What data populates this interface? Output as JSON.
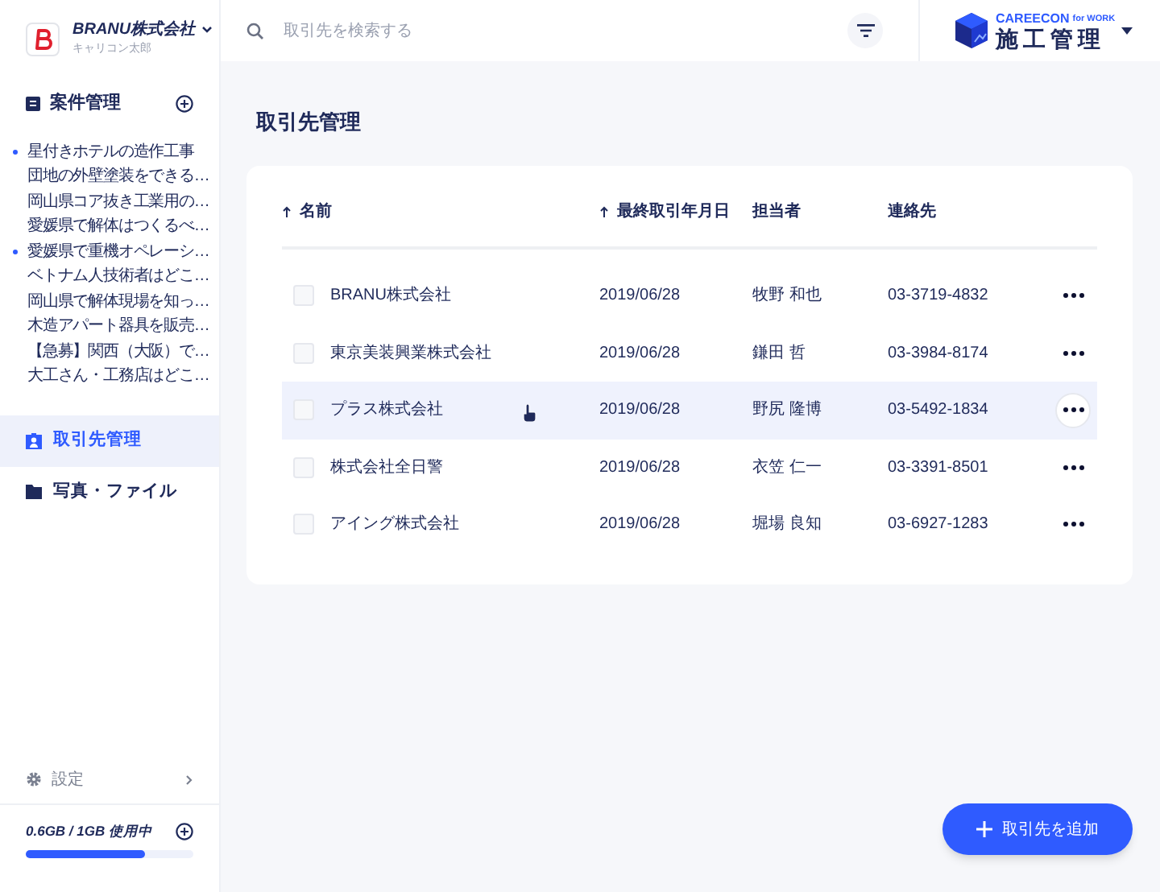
{
  "account": {
    "company": "BRANU株式会社",
    "user": "キャリコン太郎"
  },
  "projects": {
    "title": "案件管理",
    "items": [
      {
        "label": "星付きホテルの造作工事",
        "unread": true
      },
      {
        "label": "団地の外壁塗装をできる…",
        "unread": false
      },
      {
        "label": "岡山県コア抜き工業用の…",
        "unread": false
      },
      {
        "label": "愛媛県で解体はつくるべ…",
        "unread": false
      },
      {
        "label": "愛媛県で重機オペレーシ…",
        "unread": true
      },
      {
        "label": "ベトナム人技術者はどこ…",
        "unread": false
      },
      {
        "label": "岡山県で解体現場を知っ…",
        "unread": false
      },
      {
        "label": "木造アパート器具を販売…",
        "unread": false
      },
      {
        "label": "【急募】関西（大阪）で…",
        "unread": false
      },
      {
        "label": "大工さん・工務店はどこ…",
        "unread": false
      }
    ]
  },
  "nav": [
    {
      "label": "取引先管理",
      "kind": "contacts",
      "selected": true
    },
    {
      "label": "写真・ファイル",
      "kind": "folder",
      "selected": false
    }
  ],
  "settings": {
    "label": "設定"
  },
  "storage": {
    "label": "0.6GB / 1GB 使用中",
    "level": 0.71
  },
  "search": {
    "placeholder": "取引先を検索する"
  },
  "brand": {
    "tagline_main": "CAREECON",
    "tagline_sub": "for WORK",
    "product": "施工管理"
  },
  "page_title": "取引先管理",
  "table": {
    "columns": [
      {
        "label": "名前",
        "sortable": true
      },
      {
        "label": "最終取引年月日",
        "sortable": true
      },
      {
        "label": "担当者",
        "sortable": false
      },
      {
        "label": "連絡先",
        "sortable": false
      }
    ],
    "rows": [
      {
        "name": "BRANU株式会社",
        "date": "2019/06/28",
        "person": "牧野 和也",
        "phone": "03-3719-4832",
        "checked": false,
        "hovered": false
      },
      {
        "name": "東京美装興業株式会社",
        "date": "2019/06/28",
        "person": "鎌田 哲",
        "phone": "03-3984-8174",
        "checked": false,
        "hovered": false
      },
      {
        "name": "プラス株式会社",
        "date": "2019/06/28",
        "person": "野尻 隆博",
        "phone": "03-5492-1834",
        "checked": false,
        "hovered": true
      },
      {
        "name": "株式会社全日警",
        "date": "2019/06/28",
        "person": "衣笠 仁一",
        "phone": "03-3391-8501",
        "checked": false,
        "hovered": false
      },
      {
        "name": "アイング株式会社",
        "date": "2019/06/28",
        "person": "堀場 良知",
        "phone": "03-6927-1283",
        "checked": false,
        "hovered": false
      }
    ]
  },
  "add_button": {
    "label": "取引先を追加"
  }
}
